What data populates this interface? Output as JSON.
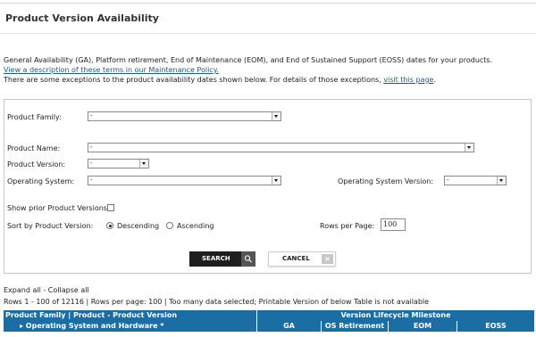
{
  "page_title": "Product Version Availability",
  "intro": {
    "line1": "General Availability (GA), Platform retirement, End of Maintenance (EOM), and End of Sustained Support (EOSS) dates for your products.",
    "link1": "View a description of these terms in our Maintenance Policy.",
    "line3_prefix": "There are some exceptions to the product availability dates shown below. For details of those exceptions, ",
    "link2": "visit this page",
    "line3_suffix": "."
  },
  "form": {
    "product_family": {
      "label": "Product Family:",
      "value": "-"
    },
    "product_name": {
      "label": "Product Name:",
      "value": "-"
    },
    "product_version": {
      "label": "Product Version:",
      "value": "-"
    },
    "operating_system": {
      "label": "Operating System:",
      "value": "-"
    },
    "os_version": {
      "label": "Operating System Version:",
      "value": "-"
    },
    "show_prior": "Show prior Product Versions:",
    "sort_label": "Sort by Product Version:",
    "sort_desc": "Descending",
    "sort_asc": "Ascending",
    "rows_label": "Rows per Page:",
    "rows_value": "100",
    "search_btn": "SEARCH",
    "cancel_btn": "CANCEL"
  },
  "results": {
    "expand_all": "Expand all",
    "separator": " - ",
    "collapse_all": "Collapse all",
    "summary": "Rows 1 - 100 of 12116 | Rows per page: 100 | Too many data selected; Printable Version of below Table is not available"
  },
  "table": {
    "col1_line1": "Product Family | Product - Product Version",
    "col1_line2": "▸ Operating System and Hardware *",
    "group_header": "Version Lifecycle Milestone",
    "columns": [
      "GA",
      "OS Retirement",
      "EOM",
      "EOSS"
    ]
  },
  "colors": {
    "header_bg": "#1b6ea4",
    "link": "#1b5a91"
  }
}
